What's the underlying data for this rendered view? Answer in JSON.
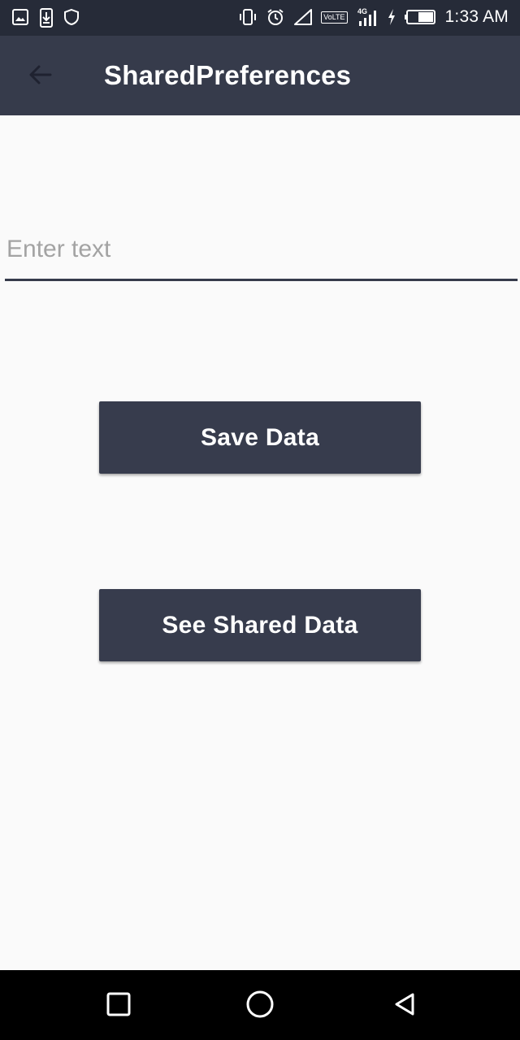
{
  "status_bar": {
    "time": "1:33 AM",
    "volte": "VoLTE",
    "network": "4G",
    "left_icons": [
      "gallery-icon",
      "download-icon",
      "shield-icon"
    ],
    "right_icons": [
      "vibrate-icon",
      "alarm-icon",
      "signal-empty-icon",
      "volte-icon",
      "signal-4g-icon",
      "charging-icon",
      "battery-icon"
    ]
  },
  "app_bar": {
    "title": "SharedPreferences",
    "back_icon": "arrow-left-icon"
  },
  "form": {
    "input_placeholder": "Enter text",
    "input_value": "",
    "save_button_label": "Save Data",
    "see_button_label": "See Shared Data"
  },
  "nav_bar": {
    "icons": [
      "recents-icon",
      "home-icon",
      "back-icon"
    ]
  },
  "colors": {
    "app_bar": "#363b4b",
    "status_bar": "#262b38",
    "button": "#373c4d",
    "background": "#fafafa",
    "nav_bar": "#000000"
  }
}
